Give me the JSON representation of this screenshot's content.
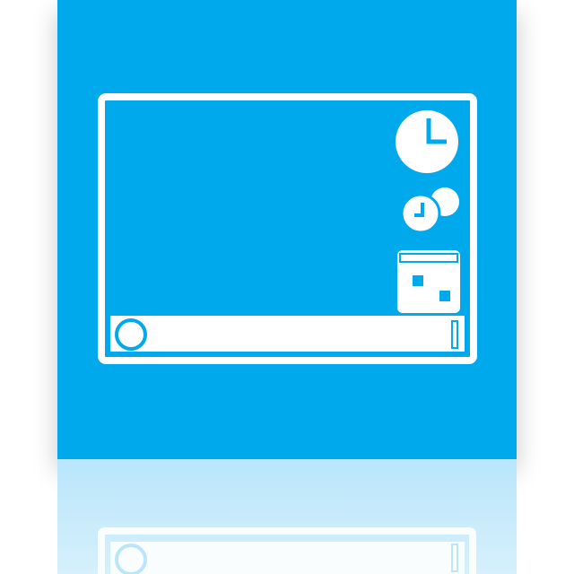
{
  "icon": {
    "name": "desktop-gadgets-icon",
    "glyphs": [
      "monitor-icon",
      "large-clock-icon",
      "small-clock-icon",
      "calendar-icon",
      "start-button-icon",
      "taskbar-icon"
    ]
  },
  "colors": {
    "tile": "#00a8ec",
    "glyph": "#ffffff",
    "reflection_top": "#b9e6fa",
    "reflection_bottom": "#d6f0fc"
  }
}
